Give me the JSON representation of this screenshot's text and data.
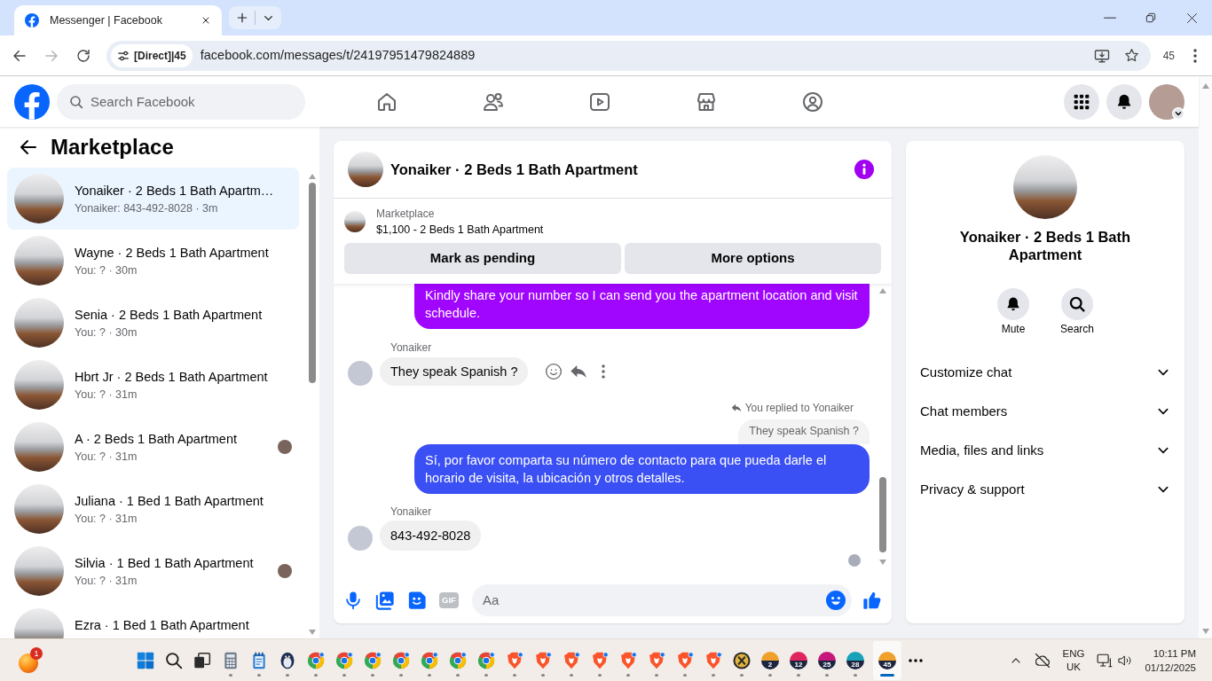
{
  "browser": {
    "tabs": [
      {
        "title": "Messenger | Facebook",
        "selected": true
      }
    ],
    "nav_buttons": [
      {
        "kind": "back",
        "disabled": false
      },
      {
        "kind": "forward",
        "disabled": true
      },
      {
        "kind": "reload",
        "disabled": false
      }
    ],
    "address": {
      "chip": "[Direct]|45",
      "url": "facebook.com/messages/t/24197951479824889"
    },
    "profile_label": "45"
  },
  "header": {
    "search": {
      "placeholder": "Search Facebook"
    },
    "nav_items": [
      {
        "kind": "home",
        "selected": false
      },
      {
        "kind": "friends",
        "selected": false
      },
      {
        "kind": "video",
        "selected": false
      },
      {
        "kind": "marketplace",
        "selected": false
      },
      {
        "kind": "groups",
        "selected": false
      }
    ]
  },
  "sidebar": {
    "title": "Marketplace",
    "conversations": [
      {
        "title": "Yonaiker · 2 Beds 1 Bath Apartm…",
        "preview": "Yonaiker: 843-492-8028 · 3m",
        "selected": true,
        "seen": false
      },
      {
        "title": "Wayne · 2 Beds 1 Bath Apartment",
        "preview": "You: ? · 30m",
        "selected": false,
        "seen": false
      },
      {
        "title": "Senia · 2 Beds 1 Bath Apartment",
        "preview": "You: ? · 30m",
        "selected": false,
        "seen": false
      },
      {
        "title": "Hbrt Jr · 2 Beds 1 Bath Apartment",
        "preview": "You: ? · 31m",
        "selected": false,
        "seen": false
      },
      {
        "title": "A · 2 Beds 1 Bath Apartment",
        "preview": "You: ? · 31m",
        "selected": false,
        "seen": true
      },
      {
        "title": "Juliana · 1 Bed 1 Bath Apartment",
        "preview": "You: ? · 31m",
        "selected": false,
        "seen": false
      },
      {
        "title": "Silvia · 1 Bed 1 Bath Apartment",
        "preview": "You: ? · 31m",
        "selected": false,
        "seen": true
      },
      {
        "title": "Ezra · 1 Bed 1 Bath Apartment",
        "selected": false,
        "seen": false
      }
    ]
  },
  "chat": {
    "title": "Yonaiker · 2 Beds 1 Bath Apartment",
    "listing": {
      "label": "Marketplace",
      "title": "$1,100 - 2 Beds 1 Bath Apartment"
    },
    "actions": [
      "Mark as pending",
      "More options"
    ],
    "messages": [
      {
        "kind": "outgoing",
        "text": "Kindly share your number so I can send you the apartment location and visit schedule.",
        "color": "#a005fe",
        "hovered": false
      },
      {
        "kind": "incoming",
        "sender": "Yonaiker",
        "text": "They speak Spanish ?",
        "hovered": true
      },
      {
        "kind": "outgoing",
        "reply_label": "You replied to Yonaiker",
        "quote": "They speak Spanish ?",
        "text": "Sí, por favor comparta su número de contacto para que pueda darle el horario de visita, la ubicación y otros detalles.",
        "color": "#3a4ff4",
        "hovered": false
      },
      {
        "kind": "incoming",
        "sender": "Yonaiker",
        "text": "843-492-8028",
        "hovered": false
      }
    ],
    "seen": true,
    "tools": [
      {
        "kind": "mic",
        "disabled": false
      },
      {
        "kind": "photo",
        "disabled": false
      },
      {
        "kind": "sticker",
        "disabled": false
      },
      {
        "kind": "gif",
        "label": "GIF",
        "disabled": true
      }
    ],
    "composer": {
      "placeholder": "Aa"
    }
  },
  "details": {
    "title": "Yonaiker · 2 Beds 1 Bath Apartment",
    "actions": [
      {
        "kind": "mute",
        "label": "Mute"
      },
      {
        "kind": "search",
        "label": "Search"
      }
    ],
    "sections": [
      {
        "label": "Customize chat",
        "expanded": false
      },
      {
        "label": "Chat members",
        "expanded": false
      },
      {
        "label": "Media, files and links",
        "expanded": false
      },
      {
        "label": "Privacy & support",
        "expanded": false
      }
    ]
  },
  "taskbar": {
    "widget": {
      "badge": "1"
    },
    "apps": [
      {
        "kind": "start",
        "running": false,
        "selected": false
      },
      {
        "kind": "search",
        "running": false,
        "selected": false
      },
      {
        "kind": "task_view",
        "running": false,
        "selected": false
      },
      {
        "kind": "calculator",
        "running": true,
        "selected": false
      },
      {
        "kind": "notepad",
        "running": true,
        "selected": false
      },
      {
        "kind": "penguin",
        "running": true,
        "selected": false
      },
      {
        "kind": "chrome",
        "running": true,
        "selected": false
      },
      {
        "kind": "chrome",
        "running": true,
        "selected": false
      },
      {
        "kind": "chrome",
        "running": true,
        "selected": false
      },
      {
        "kind": "chrome",
        "running": true,
        "selected": false
      },
      {
        "kind": "chrome",
        "running": true,
        "selected": false
      },
      {
        "kind": "chrome",
        "running": true,
        "selected": false
      },
      {
        "kind": "chrome",
        "running": true,
        "selected": false
      },
      {
        "kind": "brave",
        "running": true,
        "selected": false
      },
      {
        "kind": "brave",
        "running": true,
        "selected": false
      },
      {
        "kind": "brave",
        "running": true,
        "selected": false
      },
      {
        "kind": "brave",
        "running": true,
        "selected": false
      },
      {
        "kind": "brave",
        "running": true,
        "selected": false
      },
      {
        "kind": "brave",
        "running": true,
        "selected": false
      },
      {
        "kind": "brave",
        "running": true,
        "selected": false
      },
      {
        "kind": "brave",
        "running": true,
        "selected": false
      },
      {
        "kind": "coin",
        "running": true,
        "selected": false
      },
      {
        "kind": "gauge",
        "label": "2",
        "color": "#f0a12c",
        "running": true,
        "selected": false
      },
      {
        "kind": "gauge",
        "label": "12",
        "color": "#e0245e",
        "running": true,
        "selected": false
      },
      {
        "kind": "gauge",
        "label": "25",
        "color": "#c8177a",
        "running": true,
        "selected": false
      },
      {
        "kind": "gauge",
        "label": "28",
        "color": "#17a2b8",
        "running": true,
        "selected": false
      },
      {
        "kind": "gauge",
        "label": "45",
        "color": "#f0a12c",
        "running": true,
        "selected": true
      },
      {
        "kind": "overflow",
        "running": false,
        "selected": false
      }
    ],
    "tray": {
      "language": "ENG",
      "region": "UK",
      "time": "10:11 PM",
      "date": "01/12/2025"
    }
  }
}
